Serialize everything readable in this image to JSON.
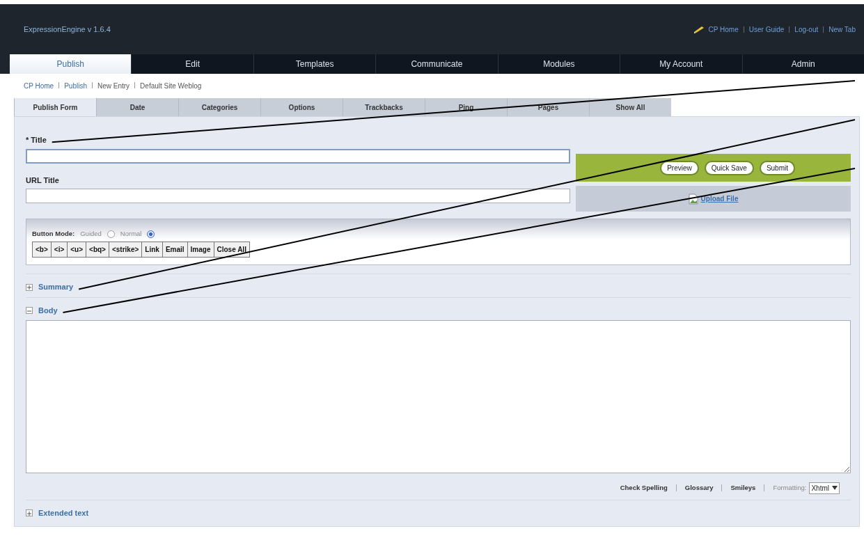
{
  "header": {
    "logo": "ExpressionEngine v 1.6.4",
    "links": [
      "CP Home",
      "User Guide",
      "Log-out",
      "New Tab"
    ]
  },
  "nav_tabs": [
    {
      "label": "Publish",
      "selected": true
    },
    {
      "label": "Edit",
      "selected": false
    },
    {
      "label": "Templates",
      "selected": false
    },
    {
      "label": "Communicate",
      "selected": false
    },
    {
      "label": "Modules",
      "selected": false
    },
    {
      "label": "My Account",
      "selected": false
    },
    {
      "label": "Admin",
      "selected": false
    }
  ],
  "breadcrumb": [
    {
      "label": "CP Home",
      "link": true
    },
    {
      "label": "Publish",
      "link": true
    },
    {
      "label": "New Entry",
      "link": false
    },
    {
      "label": "Default Site Weblog",
      "link": false
    }
  ],
  "form_tabs": [
    {
      "label": "Publish Form",
      "selected": true
    },
    {
      "label": "Date",
      "selected": false
    },
    {
      "label": "Categories",
      "selected": false
    },
    {
      "label": "Options",
      "selected": false
    },
    {
      "label": "Trackbacks",
      "selected": false
    },
    {
      "label": "Ping",
      "selected": false
    },
    {
      "label": "Pages",
      "selected": false
    },
    {
      "label": "Show All",
      "selected": false
    }
  ],
  "title_field": {
    "required_mark": "*",
    "label": "Title",
    "focused": true
  },
  "url_title_field": {
    "label": "URL Title",
    "focused": false
  },
  "actions": [
    "Preview",
    "Quick Save",
    "Submit"
  ],
  "upload": {
    "label": "Upload File"
  },
  "button_mode": {
    "label": "Button Mode:",
    "options": [
      {
        "label": "Guided",
        "selected": false
      },
      {
        "label": "Normal",
        "selected": true
      }
    ]
  },
  "format_buttons": [
    "<b>",
    "<i>",
    "<u>",
    "<bq>",
    "<strike>",
    "Link",
    "Email",
    "Image",
    "Close All"
  ],
  "sections": [
    {
      "label": "Summary",
      "expanded": false
    },
    {
      "label": "Body",
      "expanded": true
    }
  ],
  "body_tools": {
    "links": [
      "Check Spelling",
      "Glossary",
      "Smileys"
    ],
    "formatting_label": "Formatting:",
    "formatting_value": "Xhtml"
  },
  "extended": {
    "label": "Extended text",
    "expanded": false
  }
}
